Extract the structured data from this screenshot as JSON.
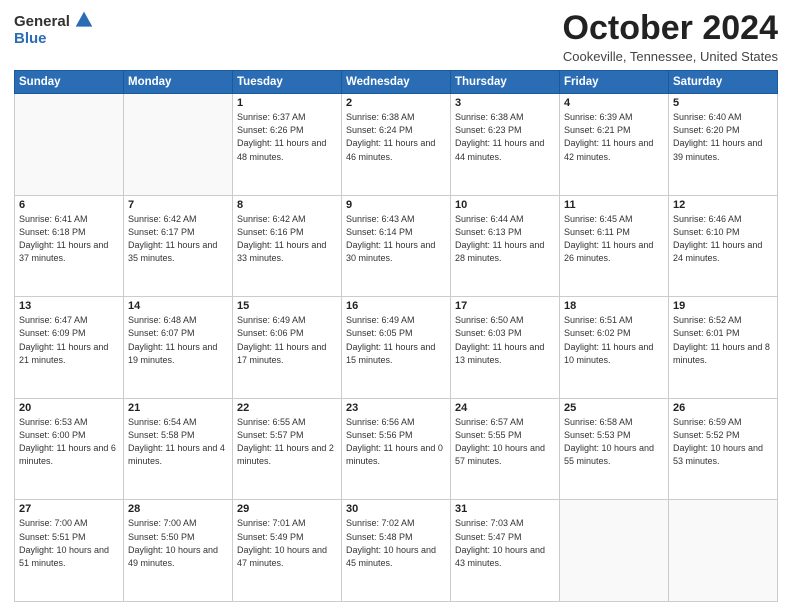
{
  "logo": {
    "general": "General",
    "blue": "Blue"
  },
  "title": "October 2024",
  "location": "Cookeville, Tennessee, United States",
  "days_header": [
    "Sunday",
    "Monday",
    "Tuesday",
    "Wednesday",
    "Thursday",
    "Friday",
    "Saturday"
  ],
  "weeks": [
    [
      {
        "day": "",
        "info": ""
      },
      {
        "day": "",
        "info": ""
      },
      {
        "day": "1",
        "info": "Sunrise: 6:37 AM\nSunset: 6:26 PM\nDaylight: 11 hours and 48 minutes."
      },
      {
        "day": "2",
        "info": "Sunrise: 6:38 AM\nSunset: 6:24 PM\nDaylight: 11 hours and 46 minutes."
      },
      {
        "day": "3",
        "info": "Sunrise: 6:38 AM\nSunset: 6:23 PM\nDaylight: 11 hours and 44 minutes."
      },
      {
        "day": "4",
        "info": "Sunrise: 6:39 AM\nSunset: 6:21 PM\nDaylight: 11 hours and 42 minutes."
      },
      {
        "day": "5",
        "info": "Sunrise: 6:40 AM\nSunset: 6:20 PM\nDaylight: 11 hours and 39 minutes."
      }
    ],
    [
      {
        "day": "6",
        "info": "Sunrise: 6:41 AM\nSunset: 6:18 PM\nDaylight: 11 hours and 37 minutes."
      },
      {
        "day": "7",
        "info": "Sunrise: 6:42 AM\nSunset: 6:17 PM\nDaylight: 11 hours and 35 minutes."
      },
      {
        "day": "8",
        "info": "Sunrise: 6:42 AM\nSunset: 6:16 PM\nDaylight: 11 hours and 33 minutes."
      },
      {
        "day": "9",
        "info": "Sunrise: 6:43 AM\nSunset: 6:14 PM\nDaylight: 11 hours and 30 minutes."
      },
      {
        "day": "10",
        "info": "Sunrise: 6:44 AM\nSunset: 6:13 PM\nDaylight: 11 hours and 28 minutes."
      },
      {
        "day": "11",
        "info": "Sunrise: 6:45 AM\nSunset: 6:11 PM\nDaylight: 11 hours and 26 minutes."
      },
      {
        "day": "12",
        "info": "Sunrise: 6:46 AM\nSunset: 6:10 PM\nDaylight: 11 hours and 24 minutes."
      }
    ],
    [
      {
        "day": "13",
        "info": "Sunrise: 6:47 AM\nSunset: 6:09 PM\nDaylight: 11 hours and 21 minutes."
      },
      {
        "day": "14",
        "info": "Sunrise: 6:48 AM\nSunset: 6:07 PM\nDaylight: 11 hours and 19 minutes."
      },
      {
        "day": "15",
        "info": "Sunrise: 6:49 AM\nSunset: 6:06 PM\nDaylight: 11 hours and 17 minutes."
      },
      {
        "day": "16",
        "info": "Sunrise: 6:49 AM\nSunset: 6:05 PM\nDaylight: 11 hours and 15 minutes."
      },
      {
        "day": "17",
        "info": "Sunrise: 6:50 AM\nSunset: 6:03 PM\nDaylight: 11 hours and 13 minutes."
      },
      {
        "day": "18",
        "info": "Sunrise: 6:51 AM\nSunset: 6:02 PM\nDaylight: 11 hours and 10 minutes."
      },
      {
        "day": "19",
        "info": "Sunrise: 6:52 AM\nSunset: 6:01 PM\nDaylight: 11 hours and 8 minutes."
      }
    ],
    [
      {
        "day": "20",
        "info": "Sunrise: 6:53 AM\nSunset: 6:00 PM\nDaylight: 11 hours and 6 minutes."
      },
      {
        "day": "21",
        "info": "Sunrise: 6:54 AM\nSunset: 5:58 PM\nDaylight: 11 hours and 4 minutes."
      },
      {
        "day": "22",
        "info": "Sunrise: 6:55 AM\nSunset: 5:57 PM\nDaylight: 11 hours and 2 minutes."
      },
      {
        "day": "23",
        "info": "Sunrise: 6:56 AM\nSunset: 5:56 PM\nDaylight: 11 hours and 0 minutes."
      },
      {
        "day": "24",
        "info": "Sunrise: 6:57 AM\nSunset: 5:55 PM\nDaylight: 10 hours and 57 minutes."
      },
      {
        "day": "25",
        "info": "Sunrise: 6:58 AM\nSunset: 5:53 PM\nDaylight: 10 hours and 55 minutes."
      },
      {
        "day": "26",
        "info": "Sunrise: 6:59 AM\nSunset: 5:52 PM\nDaylight: 10 hours and 53 minutes."
      }
    ],
    [
      {
        "day": "27",
        "info": "Sunrise: 7:00 AM\nSunset: 5:51 PM\nDaylight: 10 hours and 51 minutes."
      },
      {
        "day": "28",
        "info": "Sunrise: 7:00 AM\nSunset: 5:50 PM\nDaylight: 10 hours and 49 minutes."
      },
      {
        "day": "29",
        "info": "Sunrise: 7:01 AM\nSunset: 5:49 PM\nDaylight: 10 hours and 47 minutes."
      },
      {
        "day": "30",
        "info": "Sunrise: 7:02 AM\nSunset: 5:48 PM\nDaylight: 10 hours and 45 minutes."
      },
      {
        "day": "31",
        "info": "Sunrise: 7:03 AM\nSunset: 5:47 PM\nDaylight: 10 hours and 43 minutes."
      },
      {
        "day": "",
        "info": ""
      },
      {
        "day": "",
        "info": ""
      }
    ]
  ]
}
